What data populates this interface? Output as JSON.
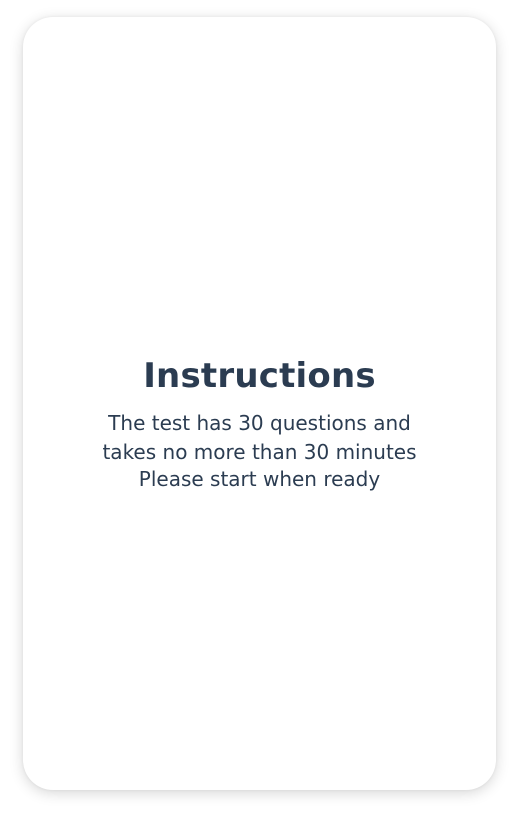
{
  "instructions": {
    "title": "Instructions",
    "lines": [
      "The test has 30 questions and",
      "takes no more than 30 minutes",
      "Please start when ready"
    ]
  },
  "colors": {
    "text": "#2b3c51",
    "card_background": "#ffffff",
    "page_background": "#ffffff"
  }
}
